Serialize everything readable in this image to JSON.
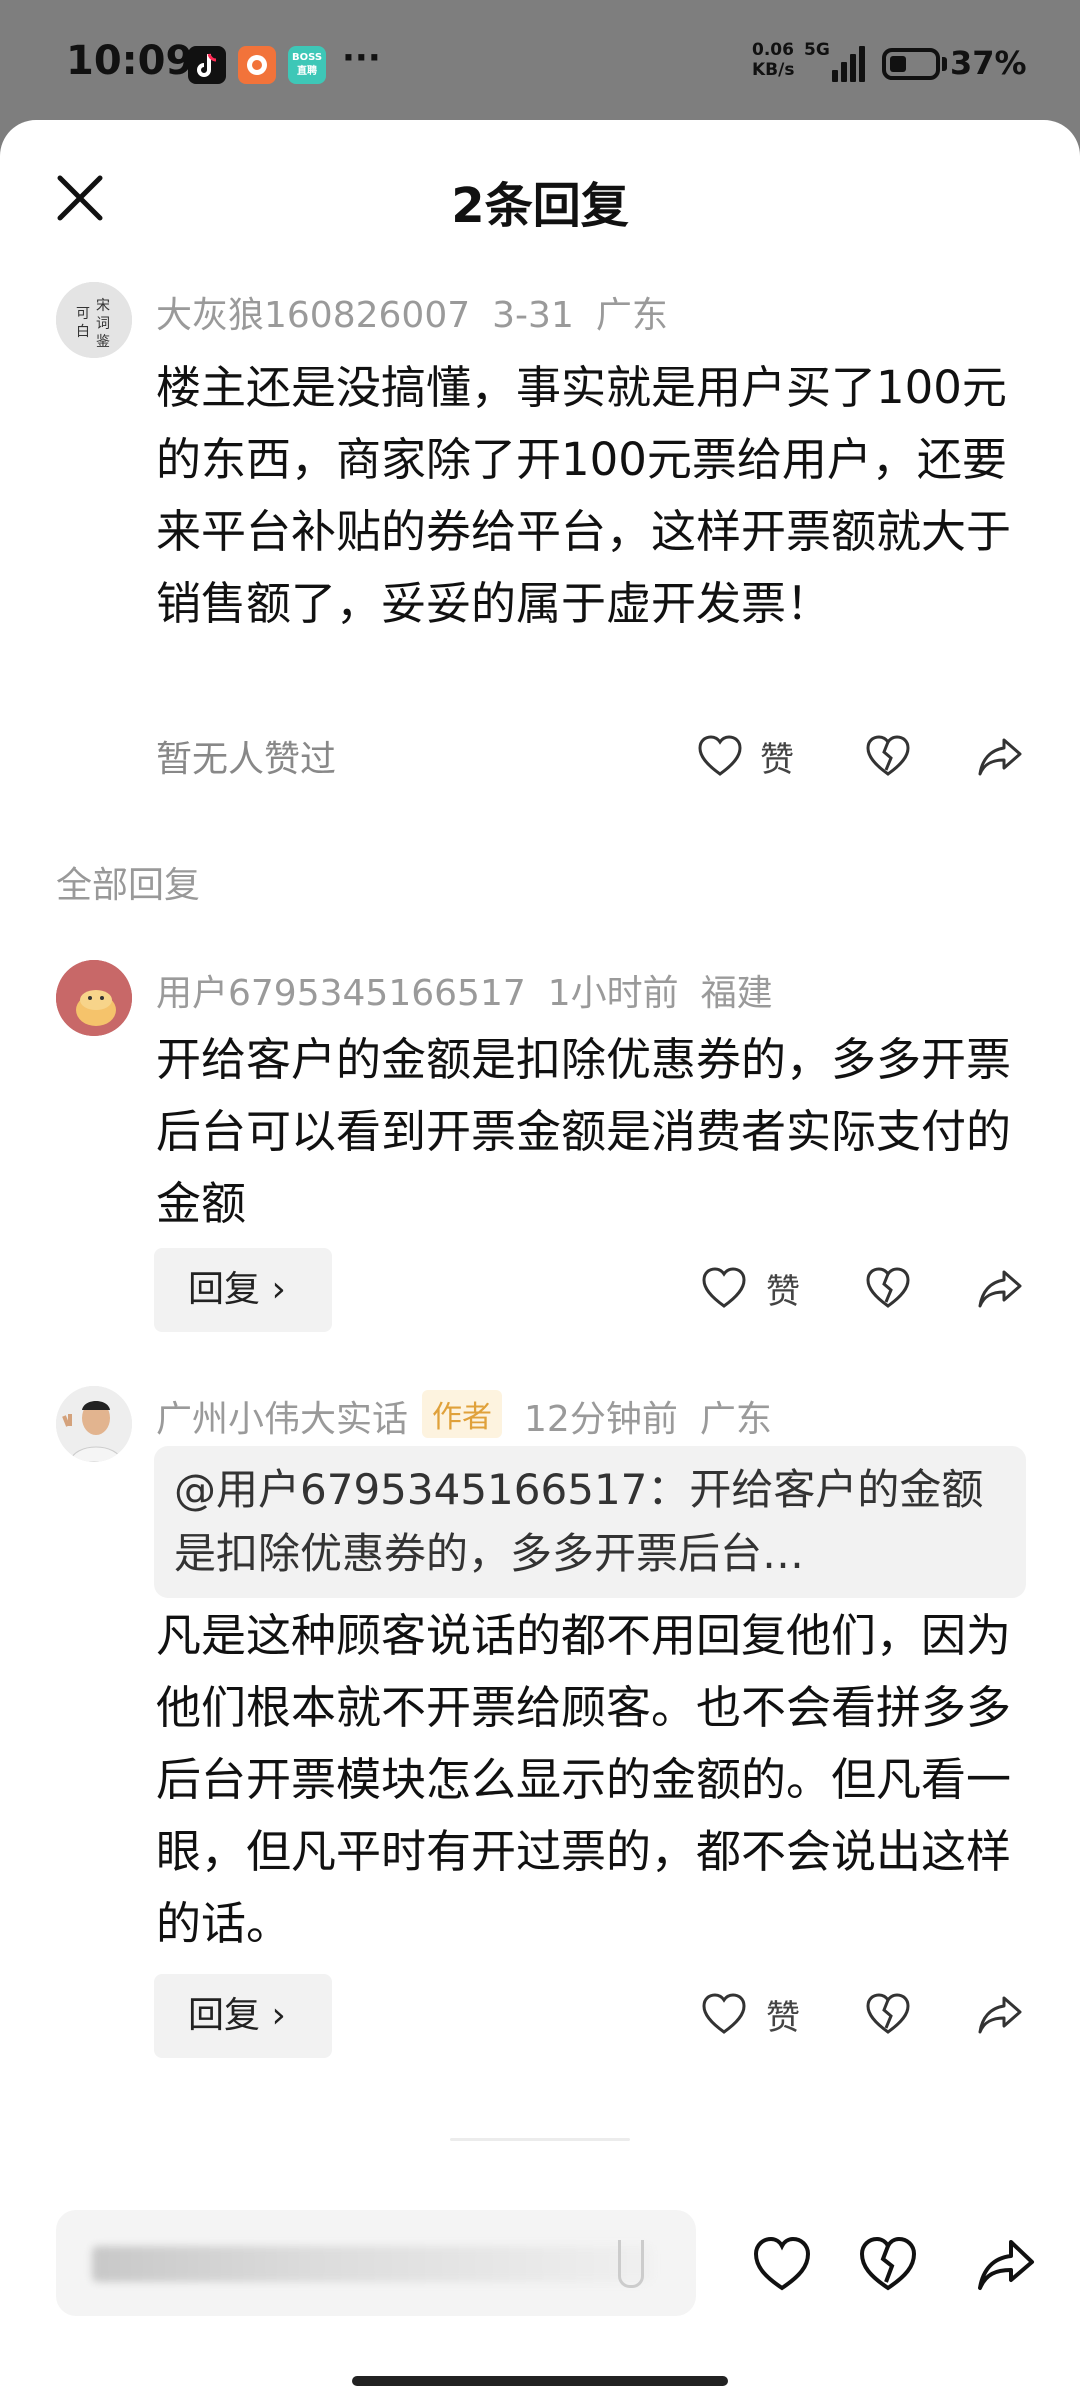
{
  "status_bar": {
    "time": "10:09",
    "apps": [
      {
        "icon": "tiktok-icon",
        "label": "",
        "color": "#111111"
      },
      {
        "icon": "orange-app-icon",
        "label": "",
        "color": "#f2733a"
      },
      {
        "icon": "boss-zhipin-icon",
        "label": "BOSS直聘",
        "color": "#3ec7b7"
      }
    ],
    "more": "···",
    "net_speed": "0.06",
    "net_unit": "KB/s",
    "network": "5G",
    "battery_percent": "37%"
  },
  "sheet": {
    "title": "2条回复"
  },
  "main_comment": {
    "username": "大灰狼160826007",
    "date": "3-31",
    "location": "广东",
    "avatar_text": "宋词鉴赏",
    "text": "楼主还是没搞懂，事实就是用户买了100元的东西，商家除了开100元票给用户，还要来平台补贴的券给平台，这样开票额就大于销售额了，妥妥的属于虚开发票！",
    "likes_text": "暂无人赞过",
    "like_label": "赞"
  },
  "section": {
    "label": "全部回复"
  },
  "replies": [
    {
      "username": "用户6795345166517",
      "time": "1小时前",
      "location": "福建",
      "text": "开给客户的金额是扣除优惠券的，多多开票后台可以看到开票金额是消费者实际支付的金额",
      "reply_label": "回复 ›",
      "like_label": "赞"
    },
    {
      "username": "广州小伟大实话",
      "badge": "作者",
      "time": "12分钟前",
      "location": "广东",
      "quote": "@用户6795345166517：开给客户的金额是扣除优惠券的，多多开票后台…",
      "text": "凡是这种顾客说话的都不用回复他们，因为他们根本就不开票给顾客。也不会看拼多多后台开票模块怎么显示的金额的。但凡看一眼，但凡平时有开过票的，都不会说出这样的话。",
      "reply_label": "回复 ›",
      "like_label": "赞"
    }
  ],
  "colors": {
    "accent_badge_bg": "#fdf3df",
    "accent_badge_text": "#e0a13a",
    "meta_text": "#9a9a9a"
  }
}
